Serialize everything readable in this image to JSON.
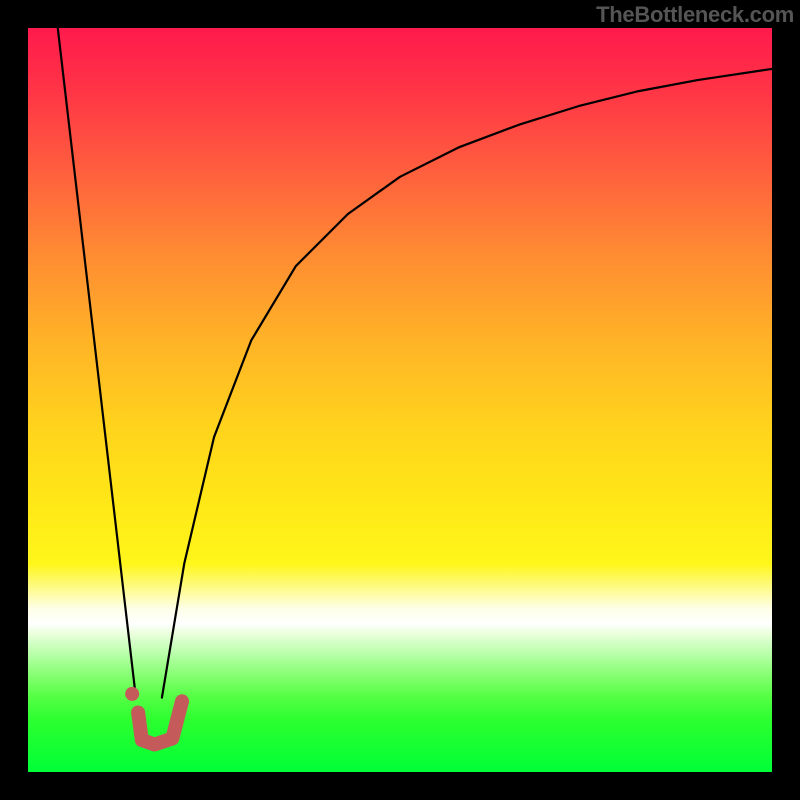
{
  "watermark": "TheBottleneck.com",
  "chart_data": {
    "type": "line",
    "title": "",
    "xlabel": "",
    "ylabel": "",
    "xlim": [
      0,
      100
    ],
    "ylim": [
      0,
      100
    ],
    "grid": false,
    "series": [
      {
        "name": "left-slope",
        "x": [
          4,
          14.5
        ],
        "y": [
          100,
          10
        ],
        "stroke": "#000000",
        "stroke_width": 2.2
      },
      {
        "name": "right-curve",
        "x": [
          18,
          21,
          25,
          30,
          36,
          43,
          50,
          58,
          66,
          74,
          82,
          90,
          100
        ],
        "y": [
          10,
          28,
          45,
          58,
          68,
          75,
          80,
          84,
          87,
          89.5,
          91.5,
          93,
          94.5
        ],
        "stroke": "#000000",
        "stroke_width": 2.2
      }
    ],
    "valley_marker": {
      "color": "#c45a5a",
      "stroke_width": 14,
      "dot": {
        "x": 14,
        "y": 10.5,
        "r": 7
      },
      "path": [
        {
          "x": 14.8,
          "y": 8
        },
        {
          "x": 15.3,
          "y": 4.3
        },
        {
          "x": 17.0,
          "y": 3.7
        },
        {
          "x": 19.4,
          "y": 4.5
        },
        {
          "x": 20.7,
          "y": 9.5
        }
      ]
    }
  }
}
